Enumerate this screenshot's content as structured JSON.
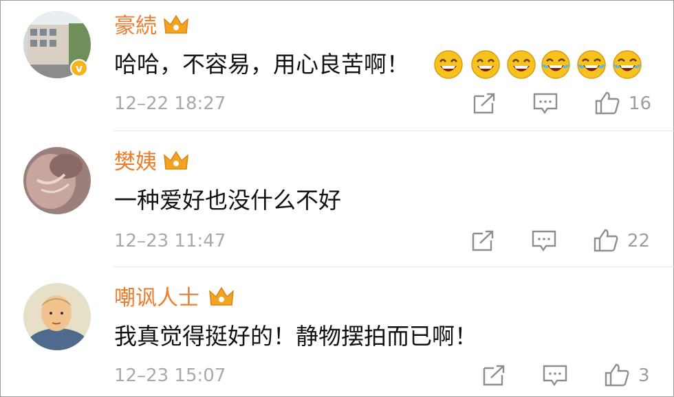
{
  "colors": {
    "username": "#ec7d2d",
    "text": "#111111",
    "meta": "#a9a9a9",
    "verified_badge": "#f6b31a",
    "crown": "#f2a31f"
  },
  "comments": [
    {
      "username": "豪続",
      "text": "哈哈，不容易，用心良苦啊！",
      "emojis": [
        "grin-emoji",
        "grin-emoji",
        "grin-emoji",
        "tears-of-joy-emoji",
        "tears-of-joy-emoji",
        "tears-of-joy-emoji"
      ],
      "time": "12–22 18:27",
      "likes": "16",
      "verified": true
    },
    {
      "username": "樊姨",
      "text": "一种爱好也没什么不好",
      "emojis": [],
      "time": "12–23 11:47",
      "likes": "22",
      "verified": false
    },
    {
      "username": "嘲讽人士",
      "text": "我真觉得挺好的！静物摆拍而已啊！",
      "emojis": [],
      "time": "12–23 15:07",
      "likes": "3",
      "verified": false
    }
  ],
  "icons": {
    "share": "share-icon",
    "comment": "comment-icon",
    "like": "thumbs-up-icon",
    "crown": "crown-icon"
  }
}
